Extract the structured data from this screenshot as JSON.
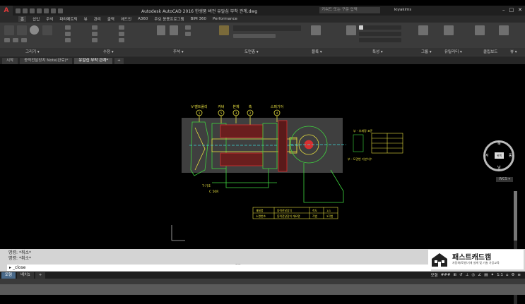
{
  "window": {
    "title": "Autodesk AutoCAD 2016   한생품 버전   유알십 부착 관계.dwg",
    "search_placeholder": "키워드 또는 구문 입력",
    "user": "kiyakims",
    "app_letter": "A"
  },
  "menu": {
    "items": [
      "홈",
      "삽입",
      "주석",
      "파라메트릭",
      "뷰",
      "관리",
      "출력",
      "애드인",
      "A360",
      "주요 응용프로그램",
      "BIM 360",
      "Performance"
    ]
  },
  "ribbon": {
    "panels": [
      "그리기 ▾",
      "수정 ▾",
      "주석 ▾",
      "도면층 ▾",
      "블록 ▾",
      "특성 ▾",
      "그룹 ▾",
      "유틸리티 ▾",
      "클립보드",
      "뷰 ▾"
    ]
  },
  "doc_tabs": {
    "items": [
      "시작",
      "동력전달장치 Note(완료)*",
      "유알십 부착 관계*"
    ],
    "active_index": 2,
    "plus": "+"
  },
  "drawing": {
    "callouts": [
      "V-벨트풀리",
      "커버",
      "본체",
      "축",
      "스퍼기어"
    ],
    "callout_numbers": [
      "1",
      "5",
      "3",
      "2",
      "4"
    ],
    "mid_labels": [
      "T-기초",
      "C 50R"
    ],
    "title_rows": [
      [
        "재질명",
        "동력전달장치",
        "척도",
        "1/1"
      ],
      [
        "소명번호",
        "동력전달장치 개요명",
        "각법",
        "3각법"
      ]
    ],
    "right_table_header": "부 - 부재정 표준",
    "right_note": "부 - 도면번 기본치수"
  },
  "viewcube": {
    "face": "위쪽",
    "north": "북",
    "south": "남",
    "west": "서",
    "east": "동",
    "wcs": "WCS ▾"
  },
  "command": {
    "history": [
      "명령: *취소*",
      "명령: *취소*"
    ],
    "input": "_close",
    "prompt_icon": "▸",
    "mid_marker": "mm"
  },
  "logo": {
    "title": "패스트캐드캠",
    "subtitle": "자동화/로봇/기계 설계 및 기술 가공교육"
  },
  "layout_tabs": {
    "items": [
      "모형",
      "배치1",
      "+"
    ],
    "active_index": 0
  },
  "status": {
    "model": "모형",
    "scale": "1:1",
    "items": [
      "###",
      "⊞",
      "↺",
      "⊥",
      "◎",
      "∠",
      "▤",
      "✦",
      "⌂",
      "⚙",
      "≡"
    ]
  },
  "colors": {
    "accent_red": "#e03a3a",
    "drawing_green": "#3fd63f",
    "drawing_yellow": "#e8e040",
    "drawing_red": "#d83030",
    "drawing_cyan": "#3fd6d6",
    "selection_gray": "#4a4a4a"
  }
}
